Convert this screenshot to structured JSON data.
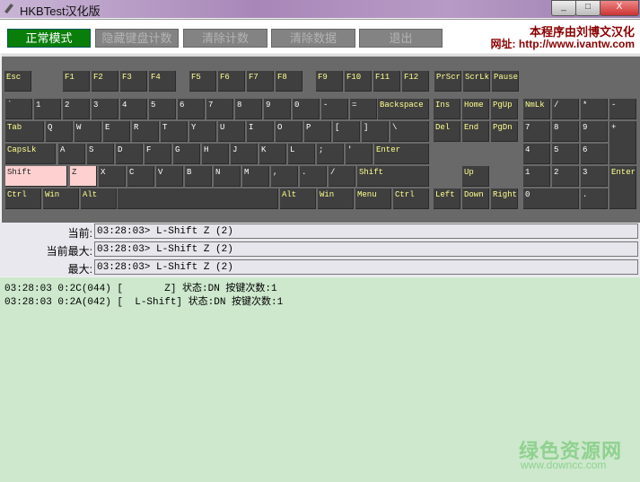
{
  "window": {
    "title": "HKBTest汉化版",
    "min": "_",
    "max": "□",
    "close": "X"
  },
  "toolbar": {
    "buttons": [
      "正常模式",
      "隐藏键盘计数",
      "清除计数",
      "清除数据",
      "退出"
    ],
    "credit_line1": "本程序由刘博文汉化",
    "credit_line2": "网址: http://www.ivantw.com"
  },
  "keyboard": {
    "keys": [
      {
        "label": "Esc"
      },
      {
        "label": "F1"
      },
      {
        "label": "F2"
      },
      {
        "label": "F3"
      },
      {
        "label": "F4"
      },
      {
        "label": "F5"
      },
      {
        "label": "F6"
      },
      {
        "label": "F7"
      },
      {
        "label": "F8"
      },
      {
        "label": "F9"
      },
      {
        "label": "F10"
      },
      {
        "label": "F11"
      },
      {
        "label": "F12"
      },
      {
        "label": "PrScr"
      },
      {
        "label": "ScrLk"
      },
      {
        "label": "Pause"
      },
      {
        "label": "`"
      },
      {
        "label": "1"
      },
      {
        "label": "2"
      },
      {
        "label": "3"
      },
      {
        "label": "4"
      },
      {
        "label": "5"
      },
      {
        "label": "6"
      },
      {
        "label": "7"
      },
      {
        "label": "8"
      },
      {
        "label": "9"
      },
      {
        "label": "0"
      },
      {
        "label": "-"
      },
      {
        "label": "="
      },
      {
        "label": "Backspace"
      },
      {
        "label": "Ins"
      },
      {
        "label": "Home"
      },
      {
        "label": "PgUp"
      },
      {
        "label": "NmLk"
      },
      {
        "label": "/"
      },
      {
        "label": "*"
      },
      {
        "label": "-"
      },
      {
        "label": "Tab"
      },
      {
        "label": "Q"
      },
      {
        "label": "W"
      },
      {
        "label": "E"
      },
      {
        "label": "R"
      },
      {
        "label": "T"
      },
      {
        "label": "Y"
      },
      {
        "label": "U"
      },
      {
        "label": "I"
      },
      {
        "label": "O"
      },
      {
        "label": "P"
      },
      {
        "label": "["
      },
      {
        "label": "]"
      },
      {
        "label": "\\"
      },
      {
        "label": "Del"
      },
      {
        "label": "End"
      },
      {
        "label": "PgDn"
      },
      {
        "label": "7"
      },
      {
        "label": "8"
      },
      {
        "label": "9"
      },
      {
        "label": "+"
      },
      {
        "label": "CapsLk"
      },
      {
        "label": "A"
      },
      {
        "label": "S"
      },
      {
        "label": "D"
      },
      {
        "label": "F"
      },
      {
        "label": "G"
      },
      {
        "label": "H"
      },
      {
        "label": "J"
      },
      {
        "label": "K"
      },
      {
        "label": "L"
      },
      {
        "label": ";"
      },
      {
        "label": "'"
      },
      {
        "label": "Enter"
      },
      {
        "label": "4"
      },
      {
        "label": "5"
      },
      {
        "label": "6"
      },
      {
        "label": "Shift",
        "pressed": true
      },
      {
        "label": "Z",
        "pressed": true
      },
      {
        "label": "X"
      },
      {
        "label": "C"
      },
      {
        "label": "V"
      },
      {
        "label": "B"
      },
      {
        "label": "N"
      },
      {
        "label": "M"
      },
      {
        "label": ","
      },
      {
        "label": "."
      },
      {
        "label": "/"
      },
      {
        "label": "Shift"
      },
      {
        "label": "Up"
      },
      {
        "label": "1"
      },
      {
        "label": "2"
      },
      {
        "label": "3"
      },
      {
        "label": "Enter"
      },
      {
        "label": "Ctrl"
      },
      {
        "label": "Win"
      },
      {
        "label": "Alt"
      },
      {
        "label": ""
      },
      {
        "label": "Alt"
      },
      {
        "label": "Win"
      },
      {
        "label": "Menu"
      },
      {
        "label": "Ctrl"
      },
      {
        "label": "Left"
      },
      {
        "label": "Down"
      },
      {
        "label": "Right"
      },
      {
        "label": "0"
      },
      {
        "label": "."
      }
    ]
  },
  "status": {
    "rows": [
      {
        "label": "当前:",
        "value": "03:28:03> L-Shift Z (2)"
      },
      {
        "label": "当前最大:",
        "value": "03:28:03> L-Shift Z (2)"
      },
      {
        "label": "最大:",
        "value": "03:28:03> L-Shift Z (2)"
      }
    ]
  },
  "log": [
    "03:28:03 0:2C(044) [       Z] 状态:DN 按键次数:1",
    "03:28:03 0:2A(042) [  L-Shift] 状态:DN 按键次数:1"
  ],
  "watermark": {
    "title": "绿色资源网",
    "url": "www.downcc.com"
  }
}
